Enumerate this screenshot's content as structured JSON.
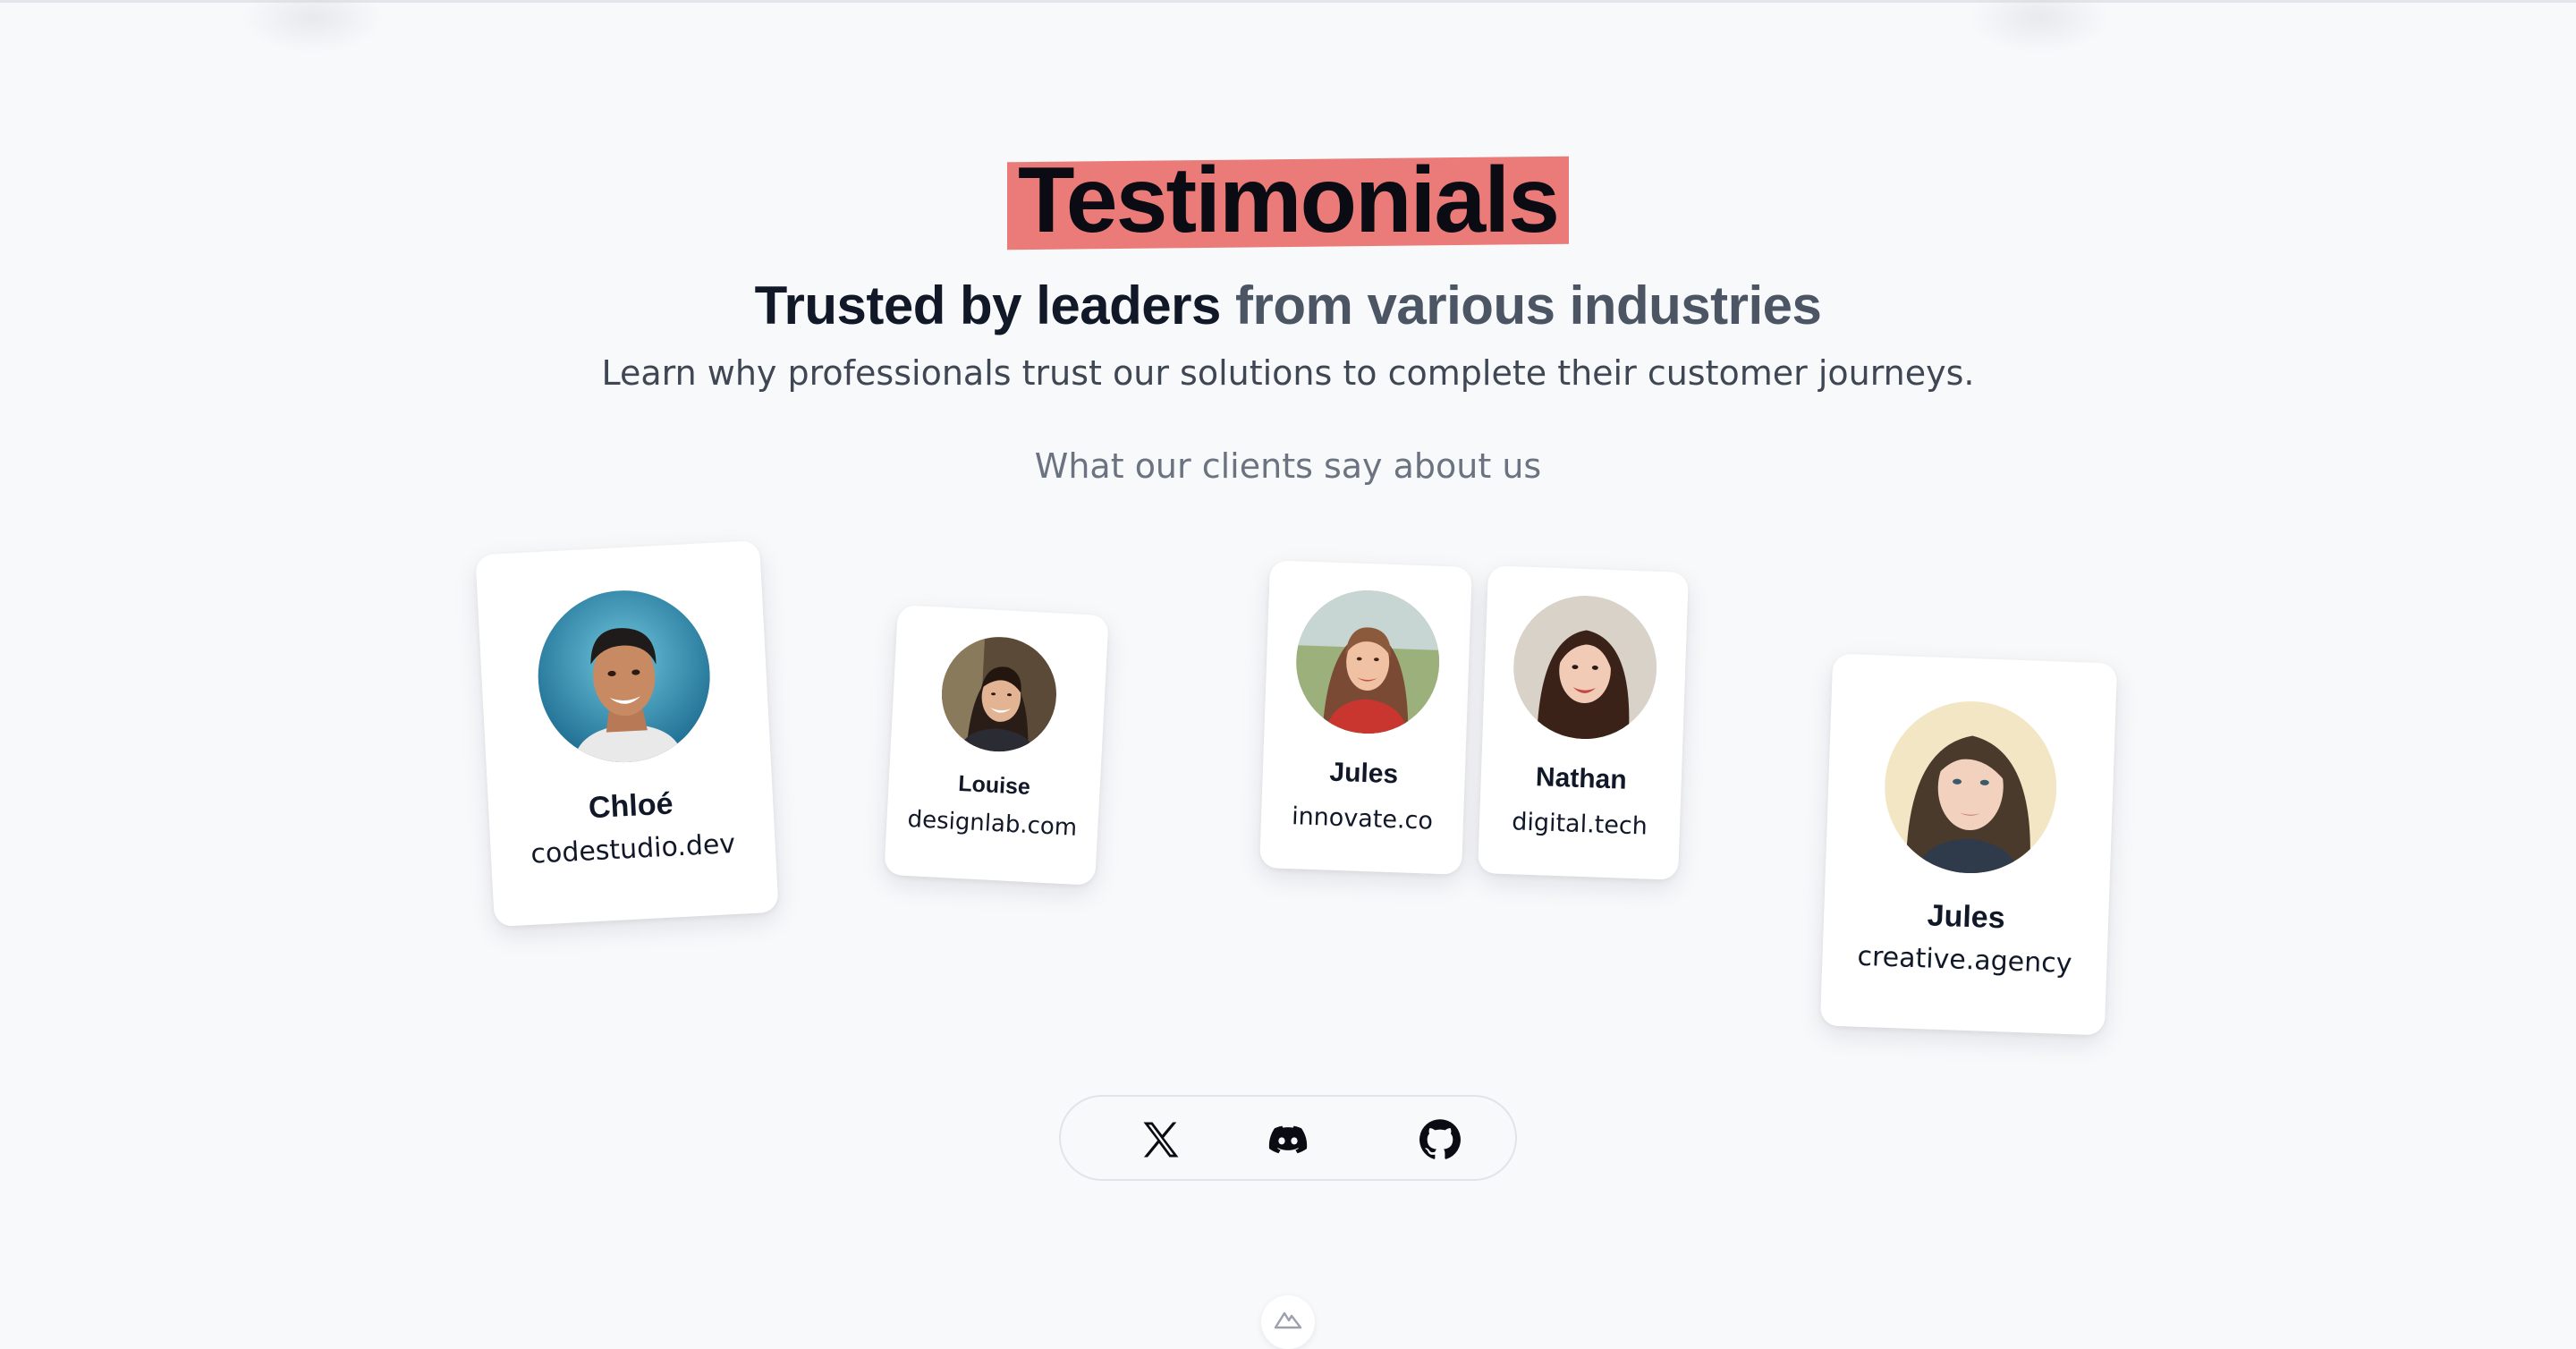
{
  "header": {
    "title": "Testimonials",
    "subtitle_strong": "Trusted by leaders",
    "subtitle_muted": "from various industries",
    "lead": "Learn why professionals trust our solutions to complete their customer journeys.",
    "section_label": "What our clients say about us"
  },
  "testimonials": [
    {
      "name": "Chloé",
      "site": "codestudio.dev",
      "avatar": "man-smiling-photo"
    },
    {
      "name": "Louise",
      "site": "designlab.com",
      "avatar": "woman-smiling-photo"
    },
    {
      "name": "Jules",
      "site": "innovate.co",
      "avatar": "woman-red-top-photo"
    },
    {
      "name": "Nathan",
      "site": "digital.tech",
      "avatar": "woman-dark-hair-photo"
    },
    {
      "name": "Jules",
      "site": "creative.agency",
      "avatar": "woman-long-hair-photo"
    }
  ],
  "social": {
    "items": [
      {
        "icon": "x-icon"
      },
      {
        "icon": "discord-icon"
      },
      {
        "icon": "github-icon"
      }
    ]
  },
  "footer": {
    "badge_icon": "nuxt-logo-icon"
  },
  "colors": {
    "background": "#f8f9fb",
    "highlight": "#ea7b78",
    "title": "#0b0b14",
    "subtitle_muted": "#4b5563",
    "section_label": "#6b7280"
  }
}
